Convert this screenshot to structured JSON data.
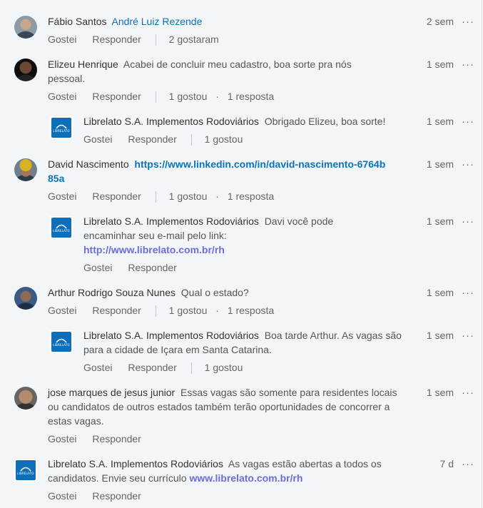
{
  "labels": {
    "like": "Gostei",
    "reply": "Responder",
    "more": "···",
    "dot": "·"
  },
  "comments": [
    {
      "author": "Fábio Santos",
      "mention": "André Luiz Rezende",
      "time": "2 sem",
      "likes": "2 gostaram"
    },
    {
      "author": "Elizeu Henrique",
      "text": "Acabei de concluir meu cadastro, boa sorte pra nós pessoal.",
      "time": "1 sem",
      "likes": "1 gostou",
      "replies": "1 resposta"
    },
    {
      "author": "Librelato S.A. Implementos Rodoviários",
      "text": "Obrigado Elizeu, boa sorte!",
      "time": "1 sem",
      "likes": "1 gostou"
    },
    {
      "author": "David Nascimento",
      "link": "https://www.linkedin.com/in/david-nascimento-6764b85a",
      "time": "1 sem",
      "likes": "1 gostou",
      "replies": "1 resposta"
    },
    {
      "author": "Librelato S.A. Implementos Rodoviários",
      "text": "Davi você pode encaminhar seu e-mail pelo link:",
      "link": "http://www.librelato.com.br/rh",
      "time": "1 sem"
    },
    {
      "author": "Arthur Rodrigo Souza Nunes",
      "text": "Qual o estado?",
      "time": "1 sem",
      "likes": "1 gostou",
      "replies": "1 resposta"
    },
    {
      "author": "Librelato S.A. Implementos Rodoviários",
      "text": "Boa tarde Arthur. As vagas são para a cidade de Içara em Santa Catarina.",
      "time": "1 sem",
      "likes": "1 gostou"
    },
    {
      "author": "jose marques de jesus junior",
      "text": "Essas vagas são somente para residentes locais ou candidatos de outros estados também terão oportunidades de concorrer a estas vagas.",
      "time": "1 sem"
    },
    {
      "author": "Librelato S.A. Implementos Rodoviários",
      "text": "As vagas estão abertas a todos os candidatos. Envie seu currículo",
      "link": "www.librelato.com.br/rh",
      "time": "7 d"
    }
  ],
  "logo_text": "LIBRELATO"
}
